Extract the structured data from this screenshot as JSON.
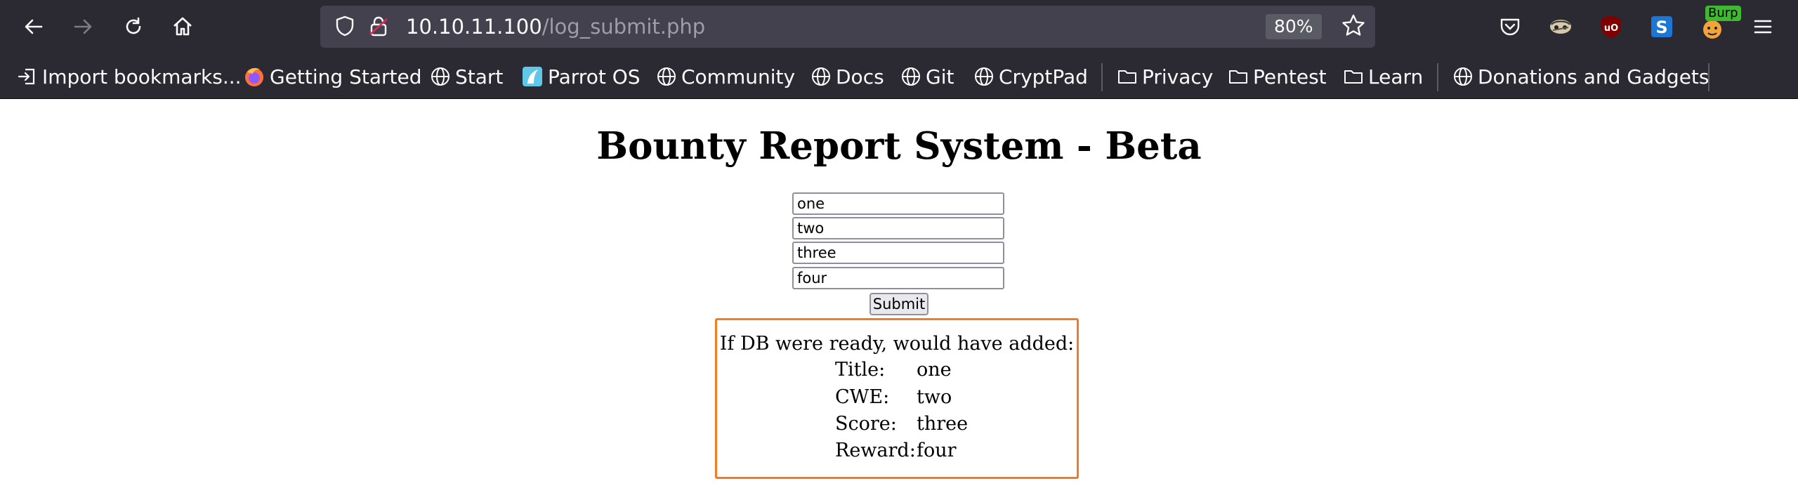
{
  "browser": {
    "url_host": "10.10.11.100",
    "url_path": "/log_submit.php",
    "zoom": "80%",
    "burp_badge": "Burp",
    "icons": [
      "back-icon",
      "forward-icon",
      "reload-icon",
      "home-icon",
      "shield-icon",
      "lock-icon",
      "star-icon",
      "pocket-icon",
      "extension-icon",
      "ublock-icon",
      "stylus-icon",
      "burp-icon",
      "menu-icon"
    ]
  },
  "bookmarks": [
    {
      "label": "Import bookmarks...",
      "icon": "import-icon"
    },
    {
      "label": "Getting Started",
      "icon": "firefox-icon"
    },
    {
      "label": "Start",
      "icon": "globe-icon"
    },
    {
      "label": "Parrot OS",
      "icon": "parrot-icon"
    },
    {
      "label": "Community",
      "icon": "globe-icon"
    },
    {
      "label": "Docs",
      "icon": "globe-icon"
    },
    {
      "label": "Git",
      "icon": "globe-icon"
    },
    {
      "label": "CryptPad",
      "icon": "globe-icon"
    },
    {
      "label": "Privacy",
      "icon": "folder-icon"
    },
    {
      "label": "Pentest",
      "icon": "folder-icon"
    },
    {
      "label": "Learn",
      "icon": "folder-icon"
    },
    {
      "label": "Donations and Gadgets",
      "icon": "globe-icon"
    }
  ],
  "page": {
    "title": "Bounty Report System - Beta",
    "fields": {
      "title": "one",
      "cwe": "two",
      "score": "three",
      "reward": "four"
    },
    "submit_label": "Submit",
    "result": {
      "header": "If DB were ready, would have added:",
      "rows": [
        {
          "key": "Title:",
          "value": "one"
        },
        {
          "key": "CWE:",
          "value": "two"
        },
        {
          "key": "Score:",
          "value": "three"
        },
        {
          "key": "Reward:",
          "value": "four"
        }
      ]
    }
  },
  "colors": {
    "accent": "#f47b20",
    "chrome": "#2b2a33",
    "urlbar": "#42414d"
  }
}
